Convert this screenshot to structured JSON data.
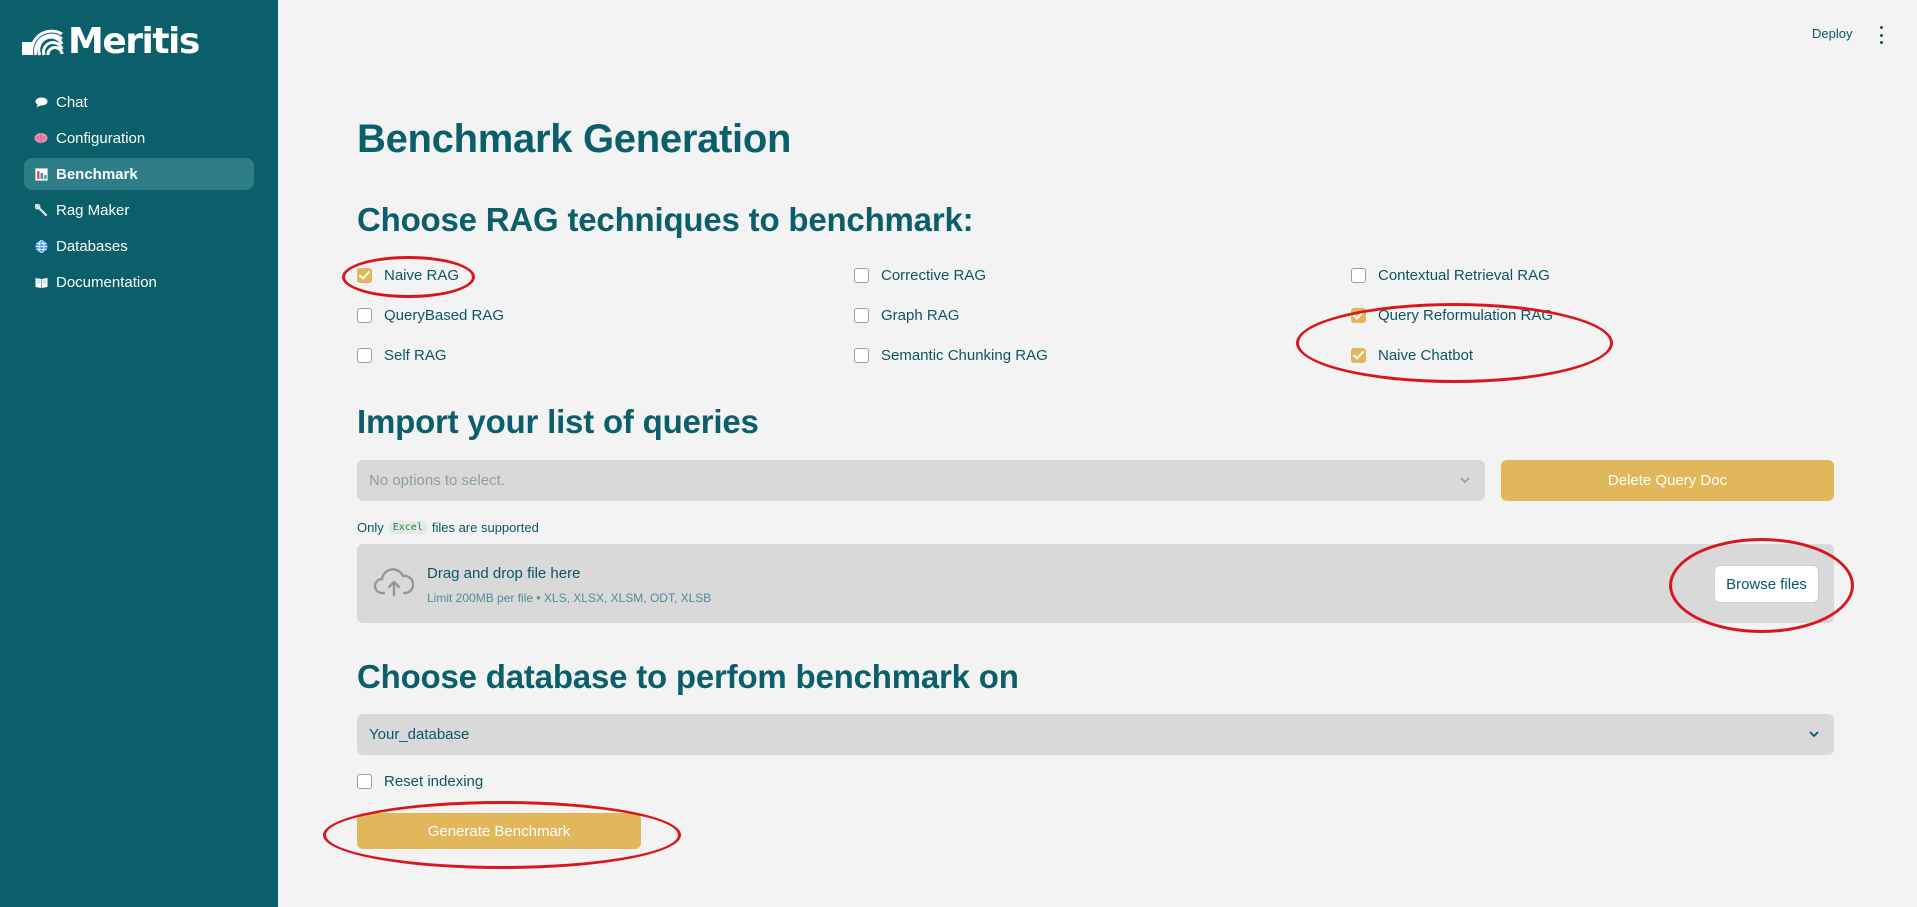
{
  "sidebar": {
    "logo_text": "Meritis",
    "items": [
      {
        "label": "Chat",
        "icon": "speech-bubble-icon",
        "active": false
      },
      {
        "label": "Configuration",
        "icon": "brain-icon",
        "active": false
      },
      {
        "label": "Benchmark",
        "icon": "bar-chart-icon",
        "active": true
      },
      {
        "label": "Rag Maker",
        "icon": "wrench-icon",
        "active": false
      },
      {
        "label": "Databases",
        "icon": "globe-icon",
        "active": false
      },
      {
        "label": "Documentation",
        "icon": "book-icon",
        "active": false
      }
    ]
  },
  "header": {
    "deploy_label": "Deploy",
    "menu_icon": "vertical-dots-icon"
  },
  "main": {
    "title": "Benchmark Generation",
    "techniques": {
      "heading": "Choose RAG techniques to benchmark:",
      "options": [
        {
          "label": "Naive RAG",
          "checked": true
        },
        {
          "label": "Corrective RAG",
          "checked": false
        },
        {
          "label": "Contextual Retrieval RAG",
          "checked": false
        },
        {
          "label": "QueryBased RAG",
          "checked": false
        },
        {
          "label": "Graph RAG",
          "checked": false
        },
        {
          "label": "Query Reformulation RAG",
          "checked": true
        },
        {
          "label": "Self RAG",
          "checked": false
        },
        {
          "label": "Semantic Chunking RAG",
          "checked": false
        },
        {
          "label": "Naive Chatbot",
          "checked": true
        }
      ]
    },
    "queries": {
      "heading": "Import your list of queries",
      "select_placeholder": "No options to select.",
      "delete_button": "Delete Query Doc",
      "note_prefix": "Only",
      "note_code": "Excel",
      "note_suffix": "files are supported",
      "dropzone": {
        "title": "Drag and drop file here",
        "limit": "Limit 200MB per file • XLS, XLSX, XLSM, ODT, XLSB",
        "browse_button": "Browse files",
        "icon": "cloud-upload-icon"
      }
    },
    "database": {
      "heading": "Choose database to perfom benchmark on",
      "selected": "Your_database",
      "reset_label": "Reset indexing",
      "reset_checked": false,
      "generate_button": "Generate Benchmark"
    }
  },
  "colors": {
    "sidebar_bg": "#0b5f6b",
    "accent": "#e2b65a",
    "text": "#0b5566",
    "annotation": "#d8161e"
  }
}
